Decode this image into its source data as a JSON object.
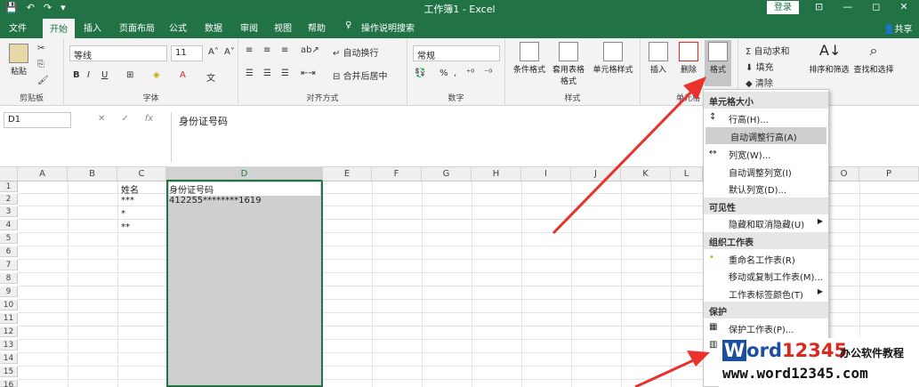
{
  "titlebar": {
    "title": "工作簿1 - Excel",
    "login": "登录",
    "qa": [
      "💾",
      "↶",
      "↷",
      "▾"
    ],
    "win": [
      "⊡",
      "—",
      "◻",
      "✕"
    ]
  },
  "tabs": [
    "文件",
    "开始",
    "插入",
    "页面布局",
    "公式",
    "数据",
    "审阅",
    "视图",
    "帮助",
    "操作说明搜索"
  ],
  "share": "共享",
  "ribbon": {
    "clipboard": {
      "paste": "粘贴",
      "label": "剪贴板"
    },
    "font": {
      "name": "等线",
      "size": "11",
      "label": "字体",
      "bold": "B",
      "italic": "I",
      "underline": "U"
    },
    "align": {
      "wrap": "自动换行",
      "merge": "合并后居中",
      "label": "对齐方式"
    },
    "number": {
      "format": "常规",
      "percent": "%",
      "label": "数字"
    },
    "styles": {
      "cond": "条件格式",
      "table": "套用表格格式",
      "cell": "单元格样式",
      "label": "样式"
    },
    "cells": {
      "insert": "插入",
      "delete": "删除",
      "format": "格式",
      "label": "单元格"
    },
    "editing": {
      "autosum": "自动求和",
      "fill": "填充",
      "clear": "清除",
      "sort": "排序和筛选",
      "find": "查找和选择"
    }
  },
  "formula_bar": {
    "namebox": "D1",
    "fx": "fx",
    "content": "身份证号码"
  },
  "grid": {
    "columns": [
      "A",
      "B",
      "C",
      "D",
      "E",
      "F",
      "G",
      "H",
      "I",
      "J",
      "K",
      "L",
      "M",
      "N",
      "O",
      "P"
    ],
    "rows": [
      "1",
      "2",
      "3",
      "4",
      "5",
      "6",
      "7",
      "8",
      "9",
      "10",
      "11",
      "12",
      "13",
      "14",
      "15",
      "16"
    ],
    "cells": {
      "c1": "姓名",
      "d1": "身份证号码",
      "c2": "***",
      "d2": "412255********1619",
      "c3": "*",
      "c4": "**"
    }
  },
  "menu": {
    "sections": [
      {
        "header": "单元格大小",
        "items": [
          "行高(H)...",
          "自动调整行高(A)",
          "列宽(W)...",
          "自动调整列宽(I)",
          "默认列宽(D)..."
        ]
      },
      {
        "header": "可见性",
        "items": [
          "隐藏和取消隐藏(U)"
        ]
      },
      {
        "header": "组织工作表",
        "items": [
          "重命名工作表(R)",
          "移动或复制工作表(M)...",
          "工作表标签颜色(T)"
        ]
      },
      {
        "header": "保护",
        "items": [
          "保护工作表(P)..."
        ]
      }
    ]
  },
  "watermark": {
    "w1": "W",
    "w2": "ord",
    "w3": "12345",
    "side": "办公软件教程",
    "url": "www.word12345.com"
  },
  "colors": {
    "excel_green": "#217346",
    "arrow_red": "#e8322b"
  }
}
